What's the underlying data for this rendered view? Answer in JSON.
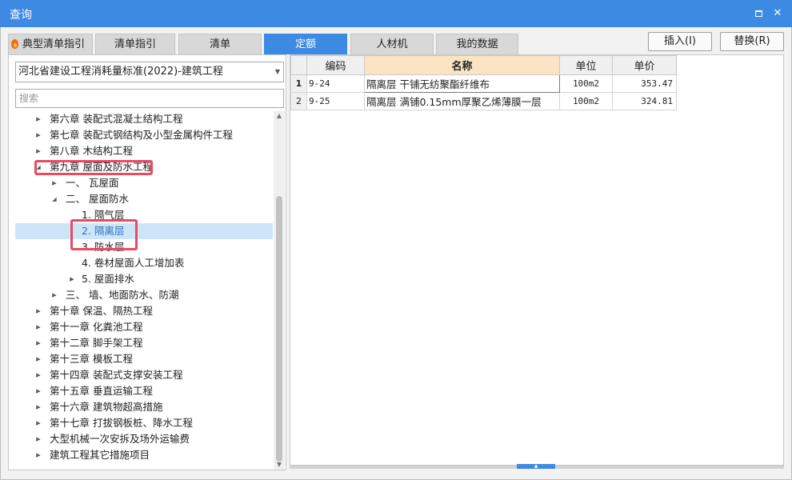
{
  "window": {
    "title": "查询",
    "maximize_icon": "maximize-icon",
    "close_icon": "close-icon",
    "close_glyph": "✕"
  },
  "colors": {
    "accent": "#3d8ae3",
    "highlight_box": "#ea4a62",
    "selected_row": "#cde6f7",
    "header_highlight": "#fbe3c4"
  },
  "tabs": [
    {
      "label": "典型清单指引",
      "icon": "fire-icon"
    },
    {
      "label": "清单指引"
    },
    {
      "label": "清单"
    },
    {
      "label": "定额",
      "active": true
    },
    {
      "label": "人材机"
    },
    {
      "label": "我的数据"
    }
  ],
  "buttons": {
    "insert": "插入(I)",
    "replace": "替换(R)"
  },
  "left": {
    "standard_select": "河北省建设工程消耗量标准(2022)-建筑工程",
    "search_placeholder": "搜索",
    "tree": [
      {
        "label": "第六章 装配式混凝土结构工程",
        "state": "collapsed"
      },
      {
        "label": "第七章 装配式钢结构及小型金属构件工程",
        "state": "collapsed"
      },
      {
        "label": "第八章 木结构工程",
        "state": "collapsed"
      },
      {
        "label": "第九章 屋面及防水工程",
        "state": "expanded",
        "highlighted": true
      },
      {
        "label": "一、 瓦屋面",
        "state": "collapsed"
      },
      {
        "label": "二、 屋面防水",
        "state": "expanded"
      },
      {
        "label": "1. 隔气层",
        "state": "leaf"
      },
      {
        "label": "2. 隔离层",
        "state": "leaf",
        "selected": true,
        "highlighted": true
      },
      {
        "label": "3. 防水层",
        "state": "leaf"
      },
      {
        "label": "4. 卷材屋面人工增加表",
        "state": "leaf"
      },
      {
        "label": "5. 屋面排水",
        "state": "collapsed"
      },
      {
        "label": "三、 墙、地面防水、防潮",
        "state": "collapsed"
      },
      {
        "label": "第十章 保温、隔热工程",
        "state": "collapsed"
      },
      {
        "label": "第十一章 化粪池工程",
        "state": "collapsed"
      },
      {
        "label": "第十二章 脚手架工程",
        "state": "collapsed"
      },
      {
        "label": "第十三章 模板工程",
        "state": "collapsed"
      },
      {
        "label": "第十四章 装配式支撑安装工程",
        "state": "collapsed"
      },
      {
        "label": "第十五章 垂直运输工程",
        "state": "collapsed"
      },
      {
        "label": "第十六章 建筑物超高措施",
        "state": "collapsed"
      },
      {
        "label": "第十七章 打拔钢板桩、降水工程",
        "state": "collapsed"
      },
      {
        "label": "大型机械一次安拆及场外运输费",
        "state": "collapsed"
      },
      {
        "label": "建筑工程其它措施项目",
        "state": "collapsed"
      }
    ]
  },
  "grid": {
    "columns": [
      "",
      "编码",
      "名称",
      "单位",
      "单价"
    ],
    "rows": [
      {
        "no": "1",
        "code": "9-24",
        "name": "隔离层 干铺无纺聚酯纤维布",
        "unit": "100m2",
        "price": "353.47"
      },
      {
        "no": "2",
        "code": "9-25",
        "name": "隔离层 满铺0.15mm厚聚乙烯薄膜一层",
        "unit": "100m2",
        "price": "324.81"
      }
    ]
  }
}
